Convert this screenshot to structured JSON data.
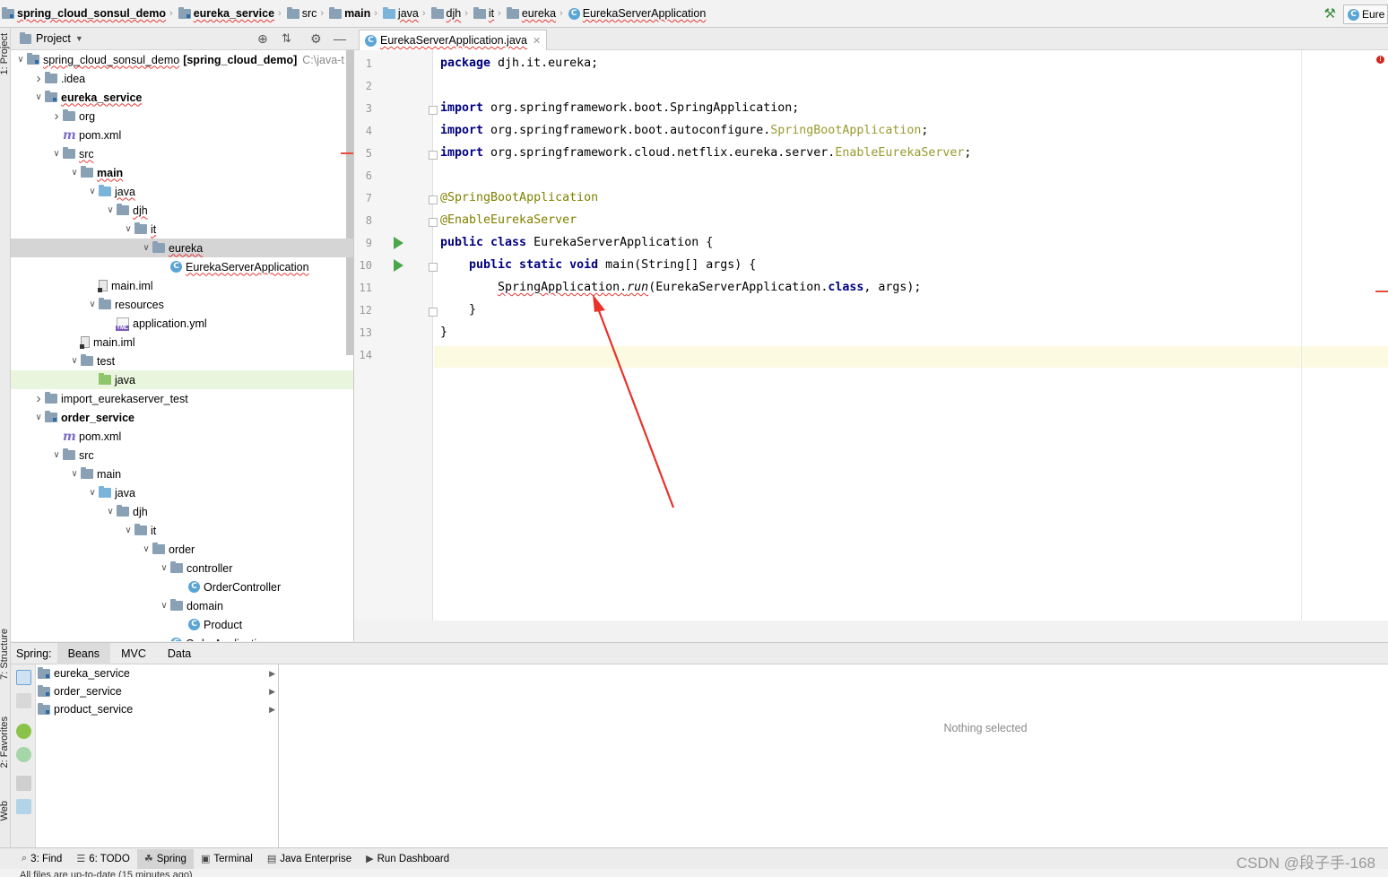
{
  "breadcrumb": [
    {
      "label": "spring_cloud_sonsul_demo",
      "bold": true,
      "squiggle": true,
      "icon": "module-folder-icon"
    },
    {
      "label": "eureka_service",
      "bold": true,
      "squiggle": true,
      "icon": "module-folder-icon"
    },
    {
      "label": "src",
      "bold": false,
      "squiggle": false,
      "icon": "folder-icon"
    },
    {
      "label": "main",
      "bold": true,
      "squiggle": false,
      "icon": "folder-icon"
    },
    {
      "label": "java",
      "bold": false,
      "squiggle": true,
      "icon": "source-folder-icon"
    },
    {
      "label": "djh",
      "bold": false,
      "squiggle": true,
      "icon": "package-icon"
    },
    {
      "label": "it",
      "bold": false,
      "squiggle": true,
      "icon": "package-icon"
    },
    {
      "label": "eureka",
      "bold": false,
      "squiggle": true,
      "icon": "package-icon"
    },
    {
      "label": "EurekaServerApplication",
      "bold": false,
      "squiggle": true,
      "icon": "class-icon"
    }
  ],
  "run_config": {
    "label": "Eure"
  },
  "project_panel": {
    "title": "Project",
    "tree": [
      {
        "indent": 0,
        "arrow": "down",
        "icon": "module",
        "label": "spring_cloud_sonsul_demo",
        "extra": "[spring_cloud_demo]",
        "hint": "C:\\java-t",
        "squiggle": true
      },
      {
        "indent": 1,
        "arrow": "right",
        "icon": "folder",
        "label": ".idea"
      },
      {
        "indent": 1,
        "arrow": "down",
        "icon": "module",
        "label": "eureka_service",
        "bold": true,
        "squiggle": true
      },
      {
        "indent": 2,
        "arrow": "right",
        "icon": "folder",
        "label": "org"
      },
      {
        "indent": 2,
        "arrow": "",
        "icon": "maven",
        "label": "pom.xml"
      },
      {
        "indent": 2,
        "arrow": "down",
        "icon": "folder",
        "label": "src",
        "squiggle": true
      },
      {
        "indent": 3,
        "arrow": "down",
        "icon": "folder",
        "label": "main",
        "bold": true,
        "squiggle": true
      },
      {
        "indent": 4,
        "arrow": "down",
        "icon": "source",
        "label": "java",
        "squiggle": true
      },
      {
        "indent": 5,
        "arrow": "down",
        "icon": "package",
        "label": "djh",
        "squiggle": true
      },
      {
        "indent": 6,
        "arrow": "down",
        "icon": "package",
        "label": "it",
        "squiggle": true
      },
      {
        "indent": 7,
        "arrow": "down",
        "icon": "package",
        "label": "eureka",
        "squiggle": true,
        "selected": true
      },
      {
        "indent": 8,
        "arrow": "",
        "icon": "class",
        "label": "EurekaServerApplication",
        "squiggle": true
      },
      {
        "indent": 4,
        "arrow": "",
        "icon": "iml",
        "label": "main.iml"
      },
      {
        "indent": 4,
        "arrow": "down",
        "icon": "folder",
        "label": "resources"
      },
      {
        "indent": 5,
        "arrow": "",
        "icon": "yml",
        "label": "application.yml"
      },
      {
        "indent": 3,
        "arrow": "",
        "icon": "iml",
        "label": "main.iml"
      },
      {
        "indent": 3,
        "arrow": "down",
        "icon": "folder",
        "label": "test"
      },
      {
        "indent": 4,
        "arrow": "",
        "icon": "testsrc",
        "label": "java",
        "highlight": true
      },
      {
        "indent": 1,
        "arrow": "right",
        "icon": "folder",
        "label": "import_eurekaserver_test"
      },
      {
        "indent": 1,
        "arrow": "down",
        "icon": "module",
        "label": "order_service",
        "bold": true
      },
      {
        "indent": 2,
        "arrow": "",
        "icon": "maven",
        "label": "pom.xml"
      },
      {
        "indent": 2,
        "arrow": "down",
        "icon": "folder",
        "label": "src"
      },
      {
        "indent": 3,
        "arrow": "down",
        "icon": "folder",
        "label": "main"
      },
      {
        "indent": 4,
        "arrow": "down",
        "icon": "source",
        "label": "java"
      },
      {
        "indent": 5,
        "arrow": "down",
        "icon": "package",
        "label": "djh"
      },
      {
        "indent": 6,
        "arrow": "down",
        "icon": "package",
        "label": "it"
      },
      {
        "indent": 7,
        "arrow": "down",
        "icon": "package",
        "label": "order"
      },
      {
        "indent": 8,
        "arrow": "down",
        "icon": "package",
        "label": "controller"
      },
      {
        "indent": 9,
        "arrow": "",
        "icon": "class",
        "label": "OrderController"
      },
      {
        "indent": 8,
        "arrow": "down",
        "icon": "package",
        "label": "domain"
      },
      {
        "indent": 9,
        "arrow": "",
        "icon": "class",
        "label": "Product"
      },
      {
        "indent": 8,
        "arrow": "",
        "icon": "class",
        "label": "OrderApplication"
      }
    ]
  },
  "editor": {
    "tab_label": "EurekaServerApplication.java",
    "line_numbers": [
      "1",
      "2",
      "3",
      "4",
      "5",
      "6",
      "7",
      "8",
      "9",
      "10",
      "11",
      "12",
      "13",
      "14"
    ],
    "lines": [
      [
        {
          "t": "package ",
          "c": "kw"
        },
        {
          "t": "djh.it.eureka;",
          "c": ""
        }
      ],
      [],
      [
        {
          "t": "import ",
          "c": "kw"
        },
        {
          "t": "org.springframework.boot.SpringApplication;",
          "c": ""
        }
      ],
      [
        {
          "t": "import ",
          "c": "kw"
        },
        {
          "t": "org.springframework.boot.autoconfigure.",
          "c": ""
        },
        {
          "t": "SpringBootApplication",
          "c": "unres"
        },
        {
          "t": ";",
          "c": ""
        }
      ],
      [
        {
          "t": "import ",
          "c": "kw"
        },
        {
          "t": "org.springframework.cloud.netflix.eureka.server.",
          "c": ""
        },
        {
          "t": "EnableEurekaServer",
          "c": "unres"
        },
        {
          "t": ";",
          "c": ""
        }
      ],
      [],
      [
        {
          "t": "@SpringBootApplication",
          "c": "ann"
        }
      ],
      [
        {
          "t": "@EnableEurekaServer",
          "c": "ann"
        }
      ],
      [
        {
          "t": "public class ",
          "c": "kw"
        },
        {
          "t": "EurekaServerApplication {",
          "c": ""
        }
      ],
      [
        {
          "t": "    public static void ",
          "c": "kw"
        },
        {
          "t": "main(String[] args) {",
          "c": ""
        }
      ],
      [
        {
          "t": "        ",
          "c": ""
        },
        {
          "t": "SpringApplication.",
          "c": "sqw"
        },
        {
          "t": "run",
          "c": "sqw it"
        },
        {
          "t": "(EurekaServerApplication.",
          "c": ""
        },
        {
          "t": "class",
          "c": "kw"
        },
        {
          "t": ", args);",
          "c": ""
        }
      ],
      [
        {
          "t": "    }",
          "c": ""
        }
      ],
      [
        {
          "t": "}",
          "c": ""
        }
      ],
      []
    ]
  },
  "spring_panel": {
    "label": "Spring:",
    "tabs": [
      "Beans",
      "MVC",
      "Data"
    ],
    "active_tab": "Beans",
    "items": [
      "eureka_service",
      "order_service",
      "product_service"
    ],
    "empty_text": "Nothing selected"
  },
  "left_stripe": {
    "project": "1: Project",
    "structure": "7: Structure",
    "favorites": "2: Favorites",
    "web": "Web"
  },
  "bottom_tabs": [
    {
      "label": "3: Find",
      "icon": "search-icon",
      "active": false
    },
    {
      "label": "6: TODO",
      "icon": "list-icon",
      "active": false
    },
    {
      "label": "Spring",
      "icon": "spring-leaf-icon",
      "active": true
    },
    {
      "label": "Terminal",
      "icon": "terminal-icon",
      "active": false
    },
    {
      "label": "Java Enterprise",
      "icon": "java-enterprise-icon",
      "active": false
    },
    {
      "label": "Run Dashboard",
      "icon": "run-dashboard-icon",
      "active": false
    }
  ],
  "status": {
    "text": "All files are up-to-date (15 minutes ago)"
  },
  "watermark": "CSDN @段子手-168",
  "colors": {
    "arrow": "#e8322a",
    "current_line": "#fcfae1",
    "keyword": "#000080",
    "annotation": "#808000"
  }
}
